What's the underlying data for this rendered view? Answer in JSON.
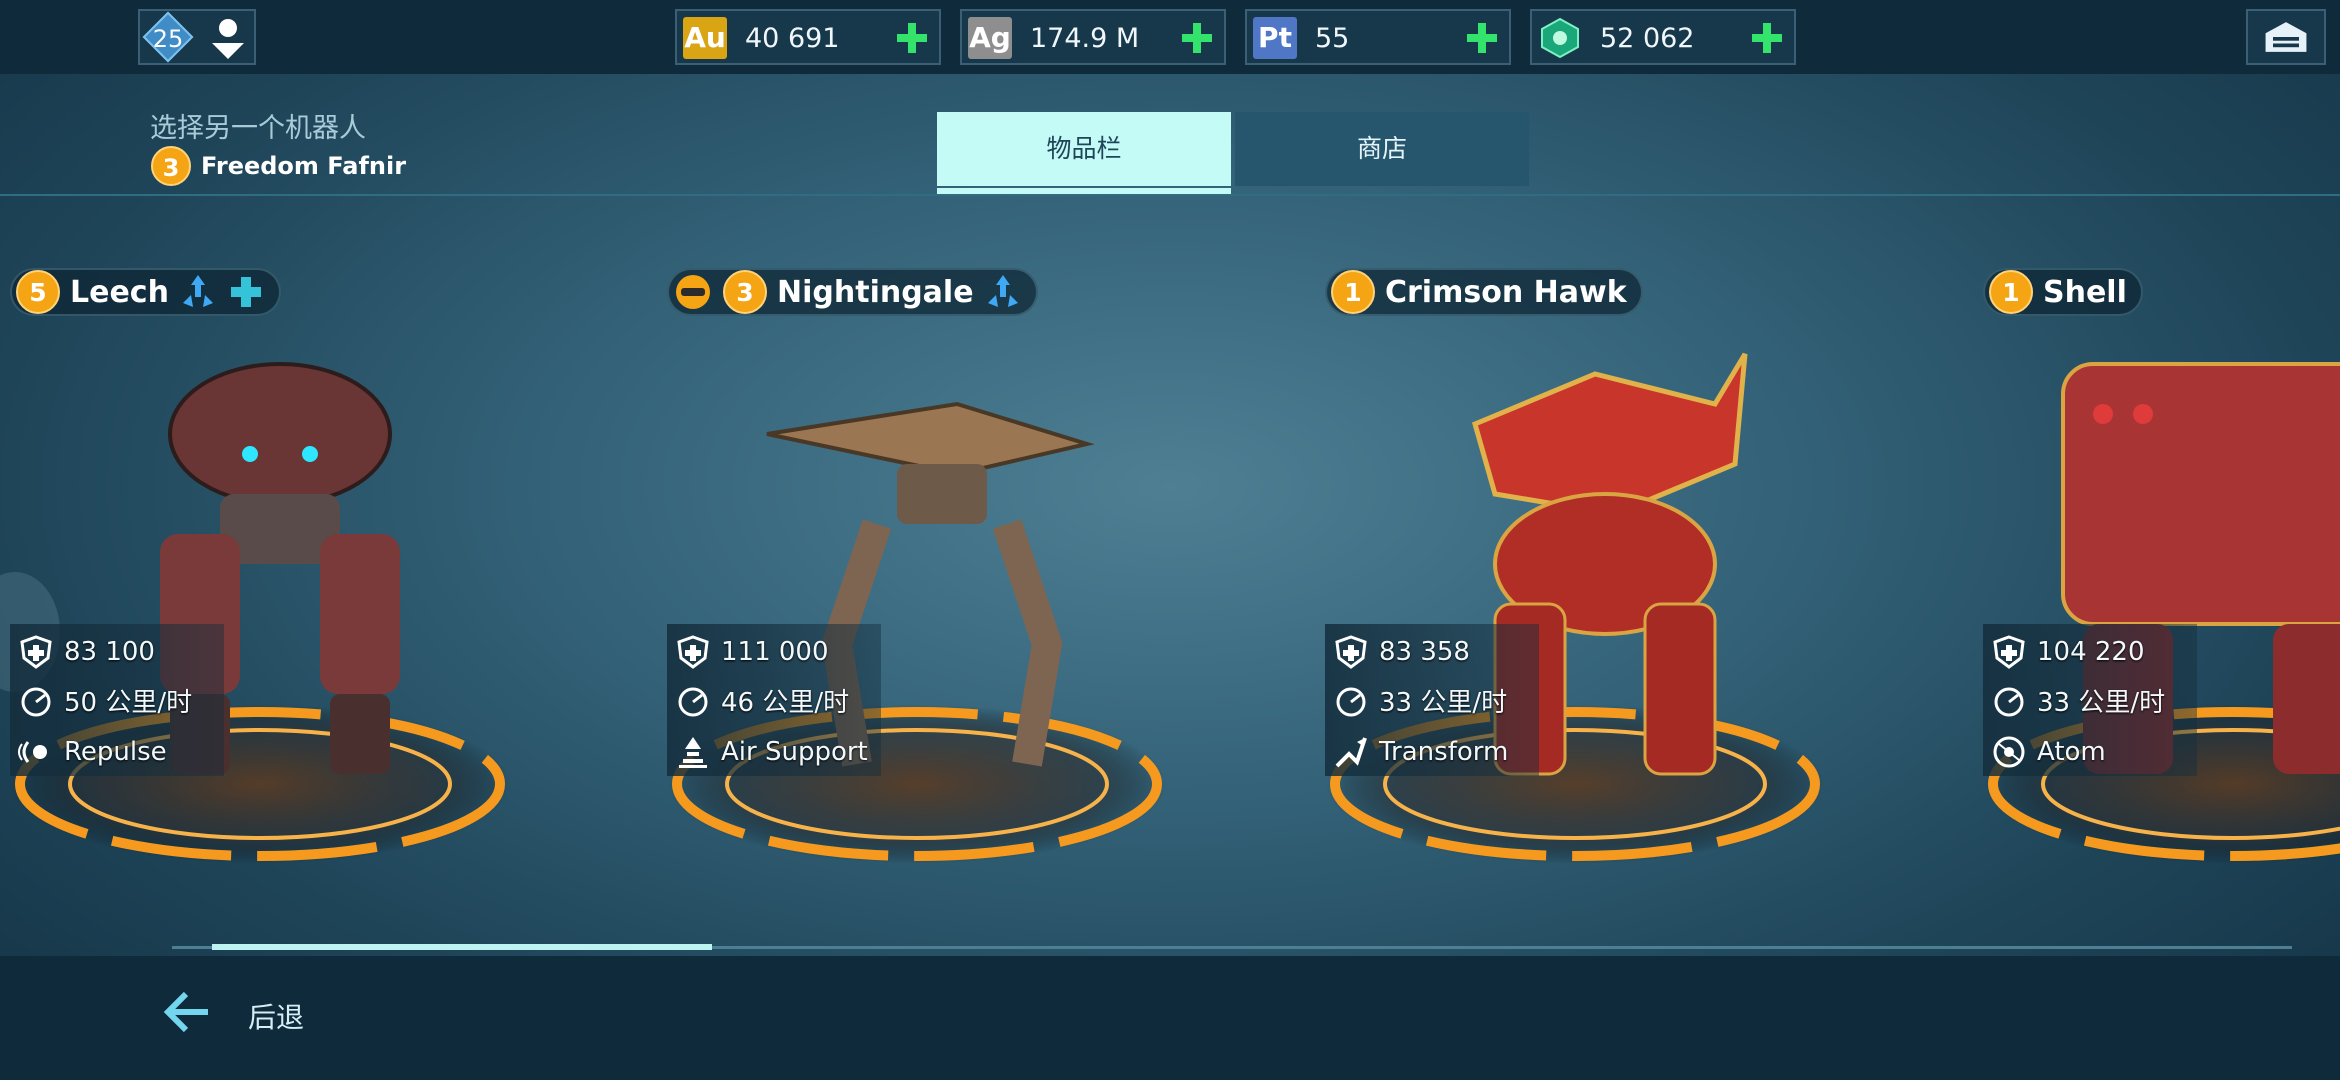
{
  "topbar": {
    "player_level": "25",
    "currencies": [
      {
        "symbol": "Au",
        "value": "40 691",
        "color": "#d9a514"
      },
      {
        "symbol": "Ag",
        "value": "174.9 M",
        "color": "#8e8e8e"
      },
      {
        "symbol": "Pt",
        "value": "55",
        "color": "#4f77c6"
      },
      {
        "symbol": "",
        "value": "52 062",
        "color": "#1aa77a"
      }
    ]
  },
  "header": {
    "select_title": "选择另一个机器人",
    "current_robot": {
      "tier": "3",
      "name": "Freedom Fafnir"
    },
    "tabs": {
      "inventory": "物品栏",
      "shop": "商店"
    }
  },
  "robots": [
    {
      "tier": "5",
      "name": "Leech",
      "durability": "83 100",
      "speed": "50 公里/时",
      "ability": "Repulse",
      "color": "#8a3a3a"
    },
    {
      "tier": "3",
      "name": "Nightingale",
      "durability": "111 000",
      "speed": "46 公里/时",
      "ability": "Air Support",
      "color": "#9b7653"
    },
    {
      "tier": "1",
      "name": "Crimson Hawk",
      "durability": "83 358",
      "speed": "33 公里/时",
      "ability": "Transform",
      "color": "#b53128"
    },
    {
      "tier": "1",
      "name": "Shell",
      "durability": "104 220",
      "speed": "33 公里/时",
      "ability": "Atom",
      "color": "#a93434"
    }
  ],
  "bottom": {
    "back_label": "后退"
  }
}
